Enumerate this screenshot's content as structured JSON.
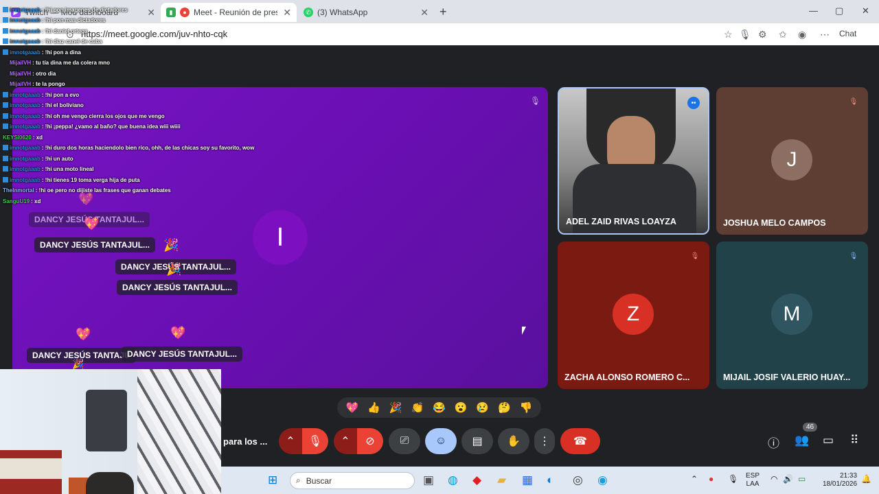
{
  "browser": {
    "tabs": [
      {
        "label": "Twitch — Mod dashboard",
        "close": "✕"
      },
      {
        "label": "Meet - Reunión de presentaci",
        "close": "✕"
      },
      {
        "label": "(3) WhatsApp",
        "close": "✕"
      }
    ],
    "new_tab": "+",
    "url": "https://meet.google.com/juv-nhto-cqk",
    "chat_button": "Chat",
    "window_controls": {
      "minimize": "—",
      "maximize": "▢",
      "close": "✕"
    }
  },
  "chat_overlay": [
    {
      "user": "imnotgaaab",
      "text": ": !hi pon imagenes de dictadores"
    },
    {
      "user": "imnotgaaab",
      "text": ": !hi pon mas dictadores"
    },
    {
      "user": "imnotgaaab",
      "text": ": !hi daniel ortega"
    },
    {
      "user": "imnotgaaab",
      "text": ": !hi diaz canel de cuba"
    },
    {
      "user": "imnotgaaab",
      "text": ": !hi pon a dina"
    },
    {
      "user": "MijailVH",
      "text": ": tu tía dina me da colera mno"
    },
    {
      "user": "MijailVH",
      "text": ": otro dia"
    },
    {
      "user": "MijailVH",
      "text": ": te la pongo"
    },
    {
      "user": "imnotgaaab",
      "text": ": !hi pon a evo"
    },
    {
      "user": "imnotgaaab",
      "text": ": !hi el boliviano"
    },
    {
      "user": "imnotgaaab",
      "text": ": !hi oh me vengo cierra los ojos que me vengo"
    },
    {
      "user": "imnotgaaab",
      "text": ": !hi ¡peppa! ¿vamo al baño? que buena idea wiii wiiii"
    },
    {
      "user": "KEYSI0620",
      "text": ": xd"
    },
    {
      "user": "imnotgaaab",
      "text": ": !hi duro dos horas haciendolo bien rico, ohh, de las chicas soy su favorito, wow"
    },
    {
      "user": "imnotgaaab",
      "text": ": !hi un auto"
    },
    {
      "user": "imnotgaaab",
      "text": ": !hi una moto lineal"
    },
    {
      "user": "imnotgaaab",
      "text": ": !hi tienes 19 toma verga hija de puta"
    },
    {
      "user": "TheInmortal",
      "text": ": !hi oe pero no dijiste las frases que ganan debates"
    },
    {
      "user": "SanguU19",
      "text": ": xd"
    }
  ],
  "stage": {
    "initial": "I",
    "mic": "🎙"
  },
  "reaction_pills": [
    "DANCY JESÚS TANTAJUL...",
    "DANCY JESÚS TANTAJUL...",
    "DANCY JESÚS TANTAJUL...",
    "DANCY JESÚS TANTAJUL...",
    "DANCY JESÚS TANTAJU",
    "DANCY JESÚS TANTAJUL..."
  ],
  "participants": [
    {
      "name": "ADEL ZAID RIVAS LOAYZA",
      "initial": "",
      "color": "#a9a9a9"
    },
    {
      "name": "JOSHUA MELO CAMPOS",
      "initial": "J",
      "color": "#6e4a40"
    },
    {
      "name": "ZACHA ALONSO ROMERO C...",
      "initial": "Z",
      "color": "#8a1c11"
    },
    {
      "name": "MIJAIL JOSIF VALERIO HUAY...",
      "initial": "M",
      "color": "#24464f"
    }
  ],
  "reactions": [
    "💖",
    "👍",
    "🎉",
    "👏",
    "😂",
    "😮",
    "😢",
    "🤔",
    "👎"
  ],
  "controls": {
    "screen_label": "para los ...",
    "participants_count": "46"
  },
  "taskbar": {
    "search_placeholder": "Buscar",
    "lang_top": "ESP",
    "lang_bottom": "LAA",
    "time": "21:33",
    "date": "18/01/2026"
  }
}
